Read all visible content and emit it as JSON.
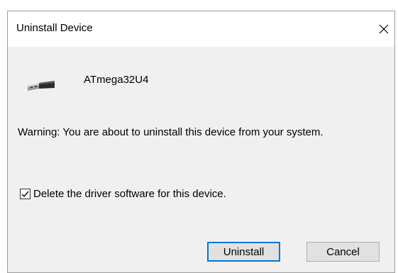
{
  "dialog": {
    "title": "Uninstall Device",
    "close_icon": "close-icon",
    "device": {
      "icon": "usb-device-icon",
      "name": "ATmega32U4"
    },
    "warning": "Warning: You are about to uninstall this device from your system.",
    "delete_driver": {
      "label": "Delete the driver software for this device.",
      "checked": true
    },
    "buttons": {
      "uninstall": "Uninstall",
      "cancel": "Cancel"
    }
  },
  "colors": {
    "accent": "#0078d7",
    "dialog_background": "#f0f0f0",
    "titlebar_background": "#ffffff",
    "button_background": "#e1e1e1"
  }
}
